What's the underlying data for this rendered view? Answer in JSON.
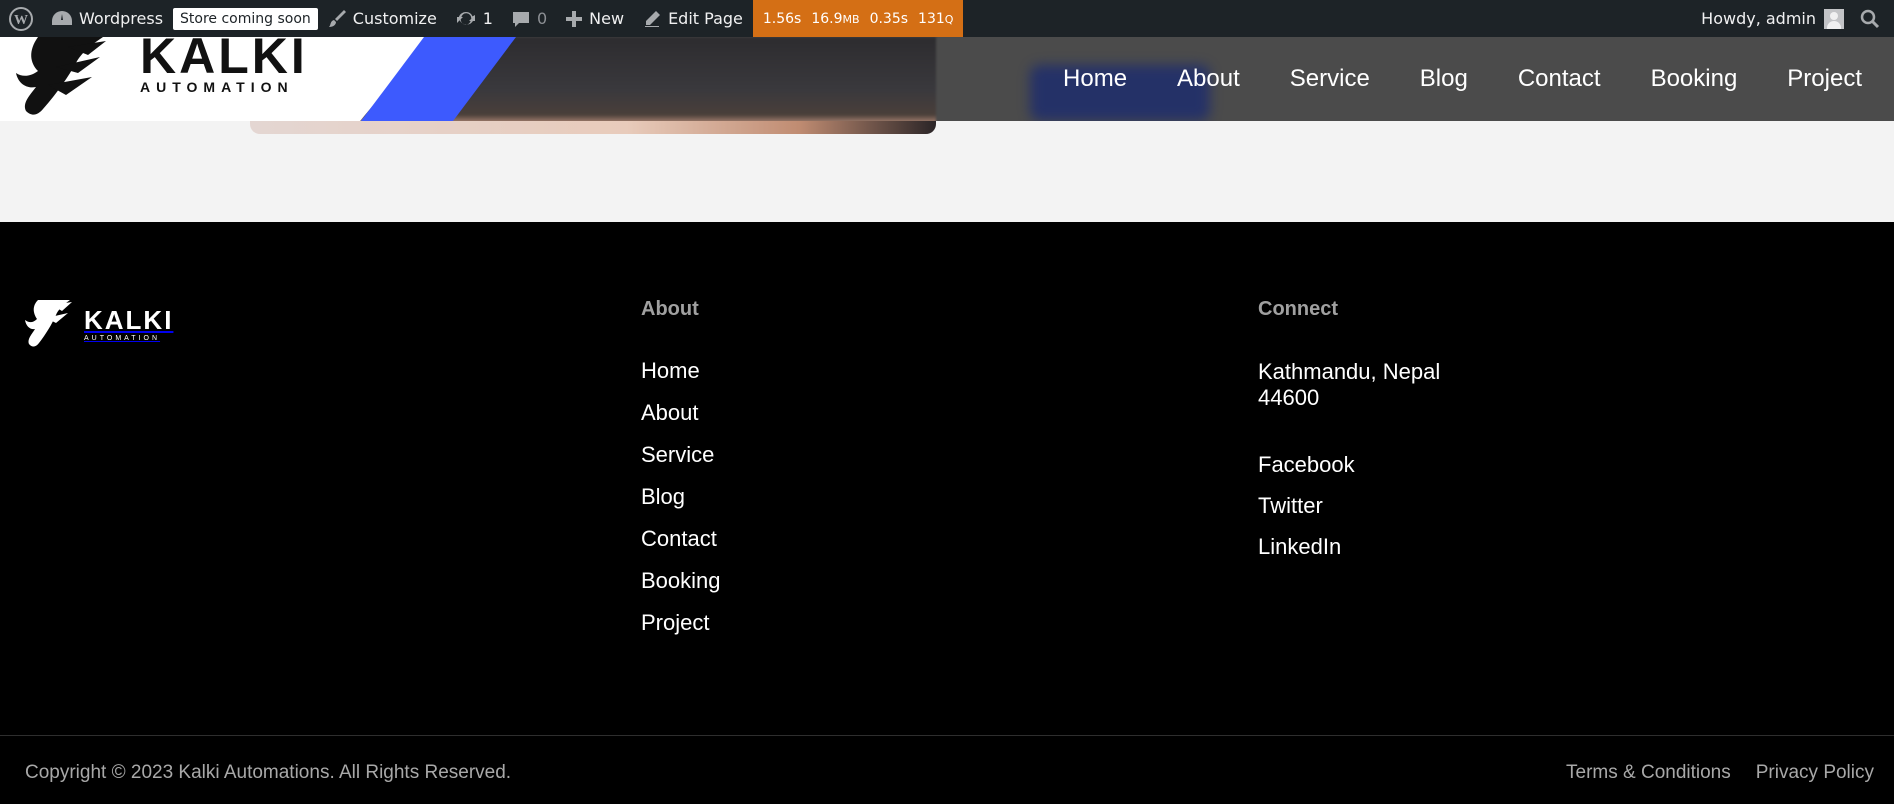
{
  "adminbar": {
    "site_name": "Wordpress",
    "store_badge": "Store coming soon",
    "customize": "Customize",
    "updates_count": "1",
    "comments_count": "0",
    "new_label": "New",
    "edit_page": "Edit Page",
    "perf": {
      "time": "1.56s",
      "memory_value": "16.9",
      "memory_unit": "MB",
      "query_time": "0.35s",
      "queries_value": "131",
      "queries_unit": "Q"
    },
    "howdy": "Howdy, admin"
  },
  "header": {
    "logo_word": "KALKI",
    "logo_sub": "AUTOMATION",
    "nav": [
      "Home",
      "About",
      "Service",
      "Blog",
      "Contact",
      "Booking",
      "Project"
    ]
  },
  "footer": {
    "logo_word": "KALKI",
    "logo_sub": "AUTOMATION",
    "about": {
      "heading": "About",
      "links": [
        "Home",
        "About",
        "Service",
        "Blog",
        "Contact",
        "Booking",
        "Project"
      ]
    },
    "connect": {
      "heading": "Connect",
      "address": "Kathmandu, Nepal 44600",
      "social": [
        "Facebook",
        "Twitter",
        "LinkedIn"
      ]
    },
    "copyright": "Copyright © 2023 Kalki Automations. All Rights Reserved.",
    "legal": [
      "Terms & Conditions",
      "Privacy Policy"
    ]
  },
  "colors": {
    "adminbar_bg": "#1d2327",
    "perf_bg": "#d46f15",
    "accent_blue": "#3d5afe",
    "footer_bg": "#000000"
  }
}
